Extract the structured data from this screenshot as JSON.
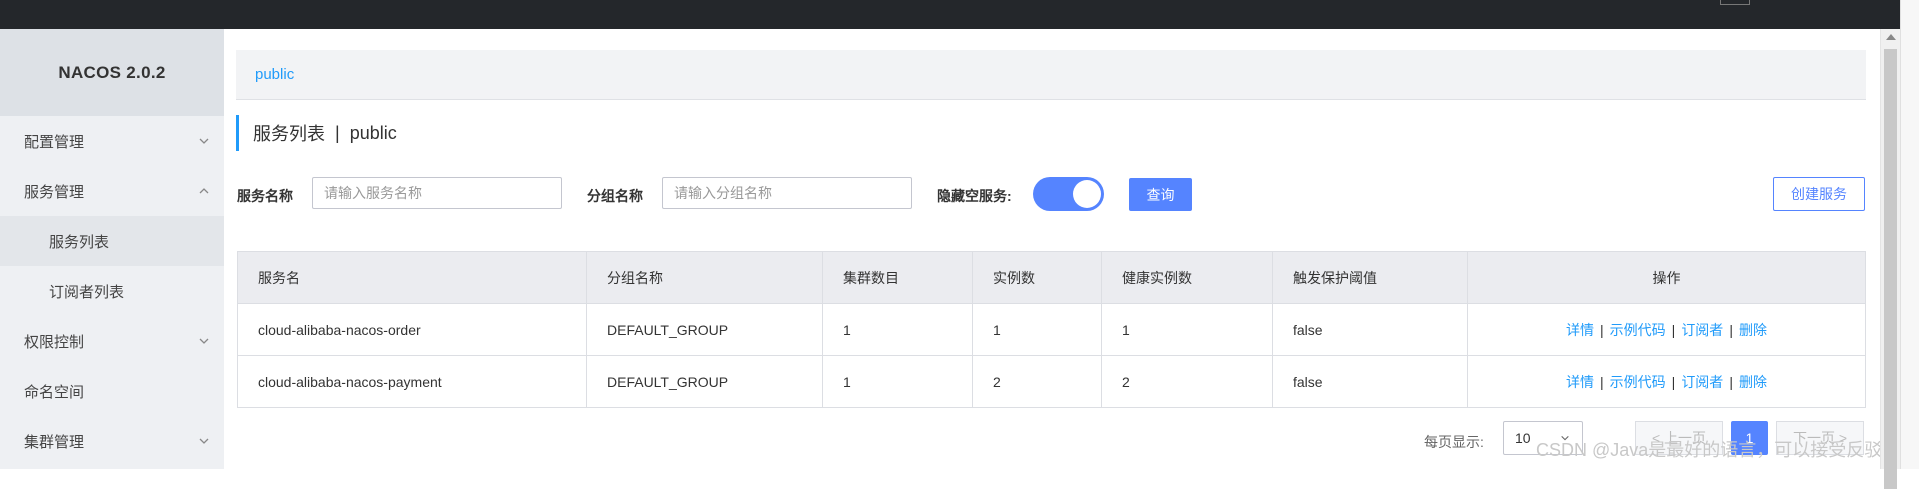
{
  "app": {
    "brand": "NACOS 2.0.2"
  },
  "sidebar": {
    "items": [
      {
        "label": "配置管理",
        "expanded": false
      },
      {
        "label": "服务管理",
        "expanded": true
      },
      {
        "label": "服务列表",
        "sub": true,
        "active": true
      },
      {
        "label": "订阅者列表",
        "sub": true
      },
      {
        "label": "权限控制",
        "expanded": false
      },
      {
        "label": "命名空间"
      },
      {
        "label": "集群管理",
        "expanded": false
      }
    ]
  },
  "breadcrumb": {
    "namespace": "public"
  },
  "page": {
    "title": "服务列表",
    "separator": "|",
    "namespace": "public"
  },
  "filters": {
    "service_name_label": "服务名称",
    "service_name_placeholder": "请输入服务名称",
    "group_name_label": "分组名称",
    "group_name_placeholder": "请输入分组名称",
    "hide_empty_label": "隐藏空服务:",
    "hide_empty_on": true,
    "query_button": "查询",
    "create_button": "创建服务"
  },
  "table": {
    "headers": [
      "服务名",
      "分组名称",
      "集群数目",
      "实例数",
      "健康实例数",
      "触发保护阈值",
      "操作"
    ],
    "rows": [
      {
        "service": "cloud-alibaba-nacos-order",
        "group": "DEFAULT_GROUP",
        "clusters": "1",
        "instances": "1",
        "healthy": "1",
        "threshold": "false"
      },
      {
        "service": "cloud-alibaba-nacos-payment",
        "group": "DEFAULT_GROUP",
        "clusters": "1",
        "instances": "2",
        "healthy": "2",
        "threshold": "false"
      }
    ],
    "actions": [
      "详情",
      "示例代码",
      "订阅者",
      "删除"
    ],
    "action_separator": "|"
  },
  "pagination": {
    "page_size_label": "每页显示:",
    "page_size": "10",
    "prev": "< 上一页",
    "current_page": "1",
    "next": "下一页 >"
  },
  "watermark": "CSDN @Java是最好的语言，可以接受反驳",
  "colors": {
    "accent": "#5584ff",
    "link": "#209bfa",
    "topbar": "#24272b",
    "sidebar": "#eef0f3"
  }
}
